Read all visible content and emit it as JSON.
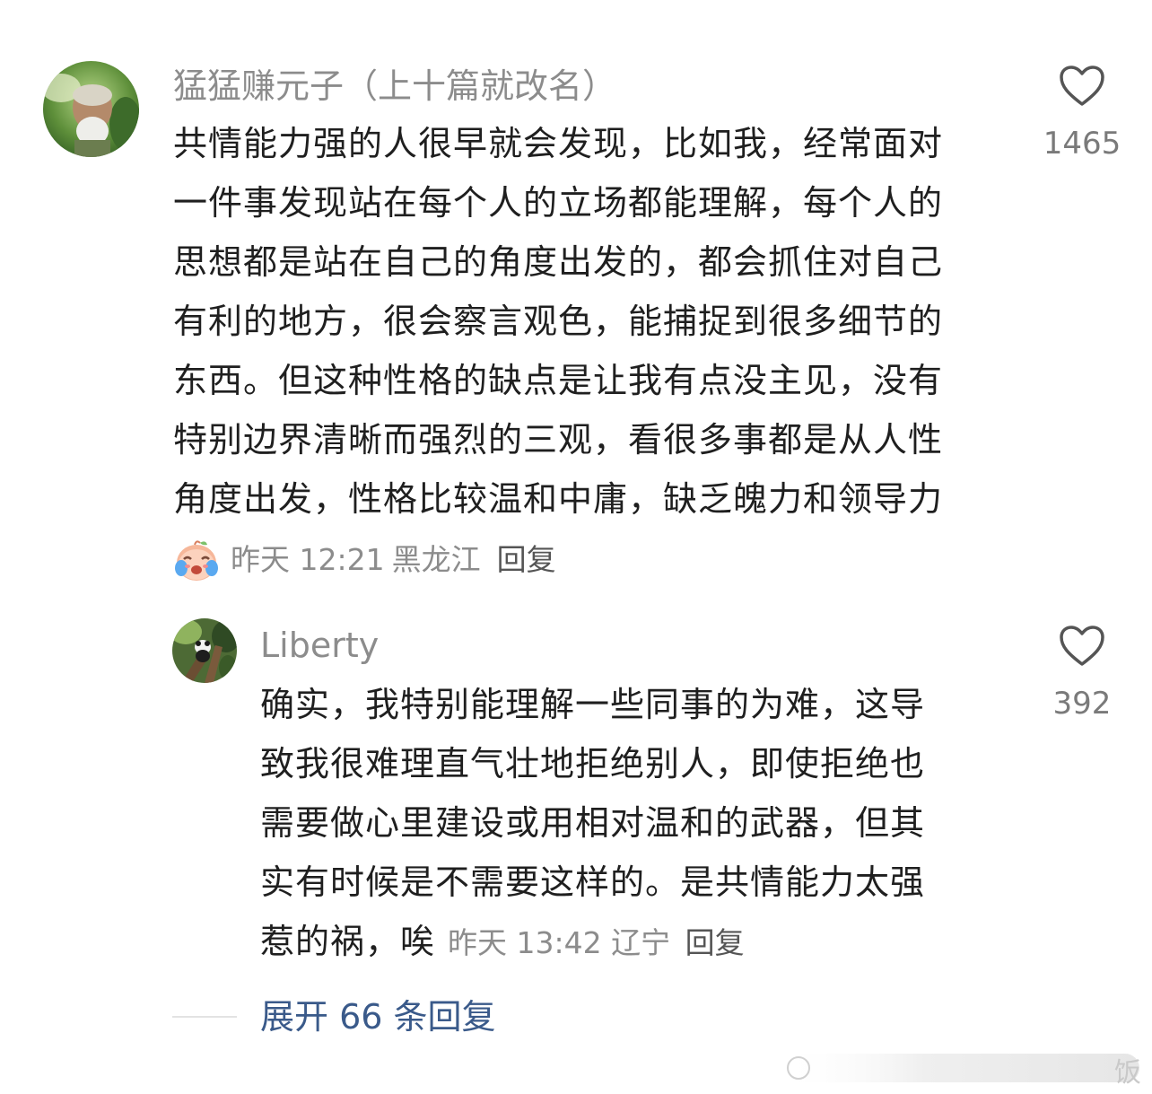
{
  "comments": [
    {
      "username": "猛猛赚元子（上十篇就改名）",
      "lines": [
        "共情能力强的人很早就会发现，比如我，经常面对",
        "一件事发现站在每个人的立场都能理解，每个人的",
        "思想都是站在自己的角度出发的，都会抓住对自己",
        "有利的地方，很会察言观色，能捕捉到很多细节的",
        "东西。但这种性格的缺点是让我有点没主见，没有",
        "特别边界清晰而强烈的三观，看很多事都是从人性",
        "角度出发，性格比较温和中庸，缺乏魄力和领导力"
      ],
      "time": "昨天 12:21",
      "location": "黑龙江",
      "reply_label": "回复",
      "likes": "1465",
      "badge_icon": "crying-emoji-icon",
      "avatar_icon": "elderly-man-photo-avatar"
    },
    {
      "username": "Liberty",
      "lines": [
        "确实，我特别能理解一些同事的为难，这导",
        "致我很难理直气壮地拒绝别人，即使拒绝也",
        "需要做心里建设或用相对温和的武器，但其",
        "实有时候是不需要这样的。是共情能力太强"
      ],
      "last_line": "惹的祸，唉",
      "time": "昨天 13:42",
      "location": "辽宁",
      "reply_label": "回复",
      "likes": "392",
      "avatar_icon": "panda-tree-photo-avatar"
    }
  ],
  "expand_replies": "展开 66 条回复",
  "watermark": "饭",
  "colors": {
    "username": "#8c8c8c",
    "body_text": "#1f1f1f",
    "meta": "#8c8c8c",
    "expand_link": "#3a5a8a",
    "heart": "#555555"
  },
  "icons": {
    "like": "heart-outline-icon"
  }
}
